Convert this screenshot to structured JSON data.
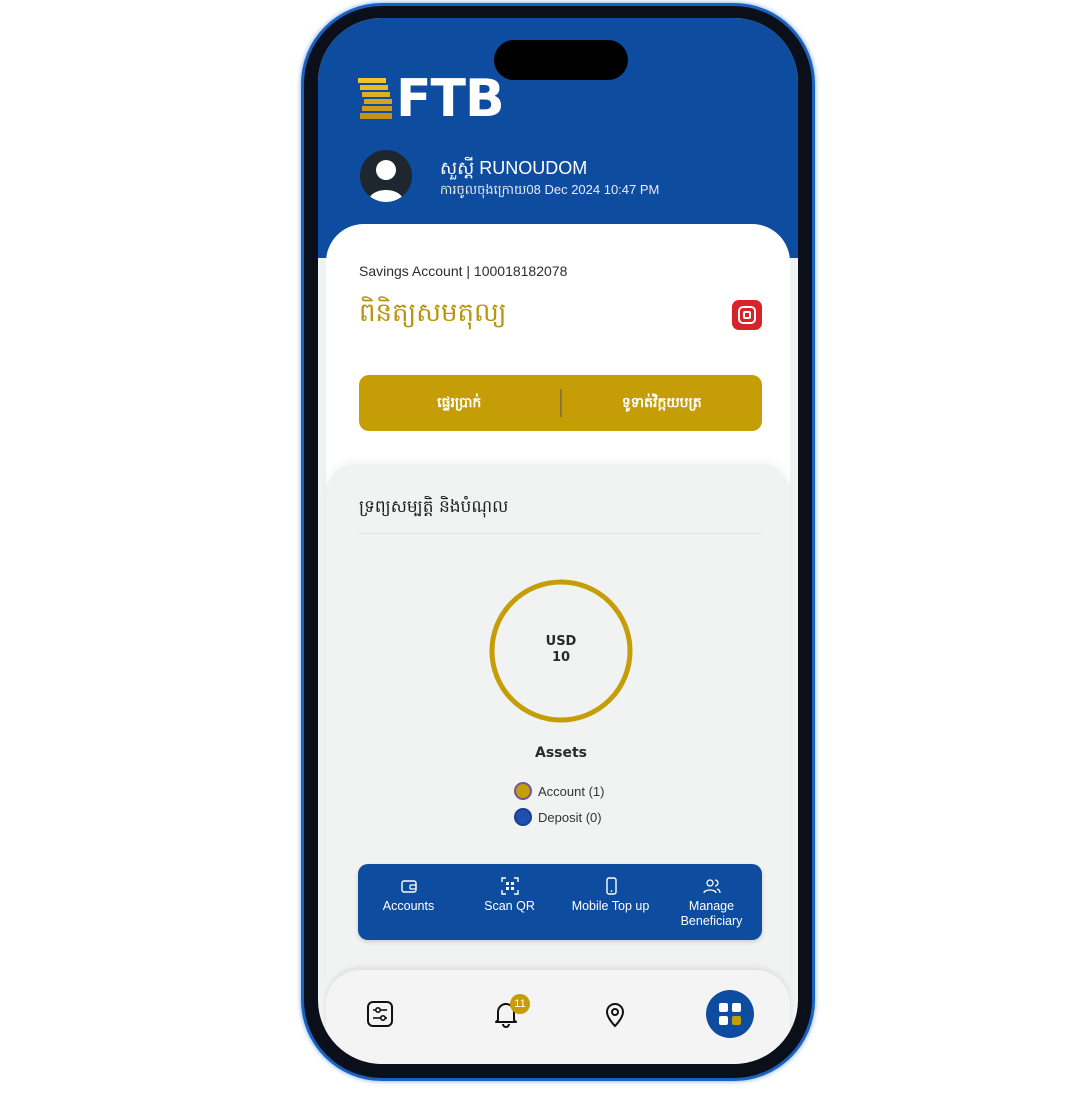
{
  "brand": {
    "name": "FTB",
    "primary": "#0e4c9f",
    "gold": "#c59d06",
    "red": "#d8232a"
  },
  "header": {
    "greeting": "សួស្តី RUNOUDOM",
    "last_login": "ការចូលចុងក្រោយ08 Dec 2024 10:47 PM"
  },
  "account": {
    "summary": "Savings Account  |  100018182078",
    "balance_title": "ពិនិត្យសមតុល្យ",
    "hide_balance_icon": "eye-toggle-icon"
  },
  "actions": {
    "transfer": "ផ្ទេរប្រាក់",
    "pay_bills": "ទូទាត់វិក្កយបត្រ"
  },
  "assets": {
    "heading": "ទ្រព្យសម្បត្តិ និងបំណុល",
    "currency": "USD",
    "total": "10",
    "title": "Assets",
    "legend": [
      {
        "label": "Account (1)",
        "color": "#c59d06"
      },
      {
        "label": "Deposit (0)",
        "color": "#1f4fb0"
      }
    ]
  },
  "chart_data": {
    "type": "pie",
    "categories": [
      "Account (1)",
      "Deposit (0)"
    ],
    "values": [
      10,
      0
    ],
    "title": "Assets"
  },
  "quick_actions": [
    {
      "label": "Accounts",
      "icon": "wallet-icon"
    },
    {
      "label": "Scan QR",
      "icon": "qr-scan-icon"
    },
    {
      "label": "Mobile Top up",
      "icon": "mobile-phone-icon"
    },
    {
      "label": "Manage Beneficiary",
      "icon": "users-icon"
    }
  ],
  "bottom_nav": {
    "notifications_count": "11",
    "items": [
      "settings-sliders-icon",
      "bell-icon",
      "location-pin-icon",
      "menu-grid-icon"
    ]
  }
}
